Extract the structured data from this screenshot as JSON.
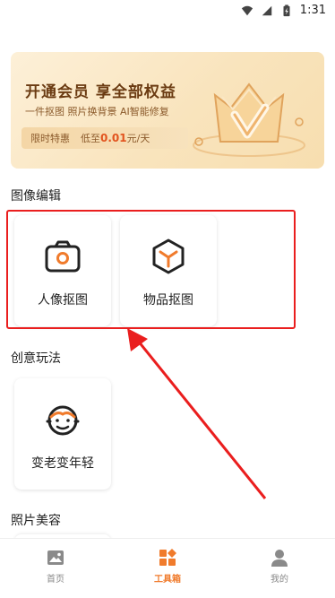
{
  "status_bar": {
    "time": "1:31"
  },
  "banner": {
    "title": "开通会员 享全部权益",
    "subtitle": "一件抠图   照片换背景   AI智能修复",
    "offer_label": "限时特惠",
    "price_prefix": "低至",
    "price": "0.01",
    "price_suffix": "元/天"
  },
  "sections": {
    "image_edit": {
      "title": "图像编辑",
      "items": [
        {
          "label": "人像抠图",
          "icon": "camera-icon"
        },
        {
          "label": "物品抠图",
          "icon": "box-icon"
        }
      ]
    },
    "creative": {
      "title": "创意玩法",
      "items": [
        {
          "label": "变老变年轻",
          "icon": "baby-face-icon"
        }
      ]
    },
    "photo_beauty": {
      "title": "照片美容"
    }
  },
  "bottom_nav": {
    "items": [
      {
        "label": "首页",
        "icon": "image-icon",
        "active": false
      },
      {
        "label": "工具箱",
        "icon": "toolbox-icon",
        "active": true
      },
      {
        "label": "我的",
        "icon": "user-icon",
        "active": false
      }
    ]
  },
  "colors": {
    "accent": "#f07b2c",
    "highlight": "#ea1e1e",
    "banner_text": "#6b3b12"
  }
}
